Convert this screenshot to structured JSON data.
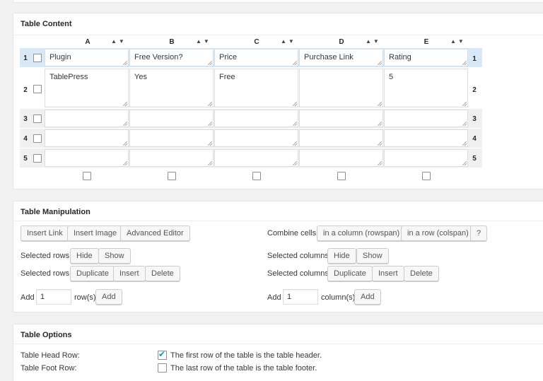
{
  "table_content": {
    "title": "Table Content",
    "columns": [
      "A",
      "B",
      "C",
      "D",
      "E"
    ],
    "rows": [
      {
        "num": "1",
        "cells": [
          "Plugin",
          "Free Version?",
          "Price",
          "Purchase Link",
          "Rating"
        ]
      },
      {
        "num": "2",
        "cells": [
          "TablePress",
          "Yes",
          "Free",
          "",
          "5"
        ]
      },
      {
        "num": "3",
        "cells": [
          "",
          "",
          "",
          "",
          ""
        ]
      },
      {
        "num": "4",
        "cells": [
          "",
          "",
          "",
          "",
          ""
        ]
      },
      {
        "num": "5",
        "cells": [
          "",
          "",
          "",
          "",
          ""
        ]
      }
    ]
  },
  "table_manipulation": {
    "title": "Table Manipulation",
    "insert_link": "Insert Link",
    "insert_image": "Insert Image",
    "advanced_editor": "Advanced Editor",
    "combine_cells_label": "Combine cells:",
    "combine_column": "in a column (rowspan)",
    "combine_row": "in a row (colspan)",
    "help": "?",
    "selected_rows_label": "Selected rows:",
    "selected_columns_label": "Selected columns:",
    "hide": "Hide",
    "show": "Show",
    "duplicate": "Duplicate",
    "insert": "Insert",
    "delete": "Delete",
    "add_label": "Add",
    "add_rows_value": "1",
    "add_columns_value": "1",
    "rows_suffix": "row(s)",
    "columns_suffix": "column(s)",
    "add_button": "Add"
  },
  "table_options": {
    "title": "Table Options",
    "head_row_label": "Table Head Row:",
    "head_row_text": "The first row of the table is the table header.",
    "head_row_checked": true,
    "foot_row_label": "Table Foot Row:",
    "foot_row_text": "The last row of the table is the table footer.",
    "foot_row_checked": false
  },
  "colors": {
    "highlight_row": "#d9e8f6",
    "accent": "#1e8cbe"
  }
}
